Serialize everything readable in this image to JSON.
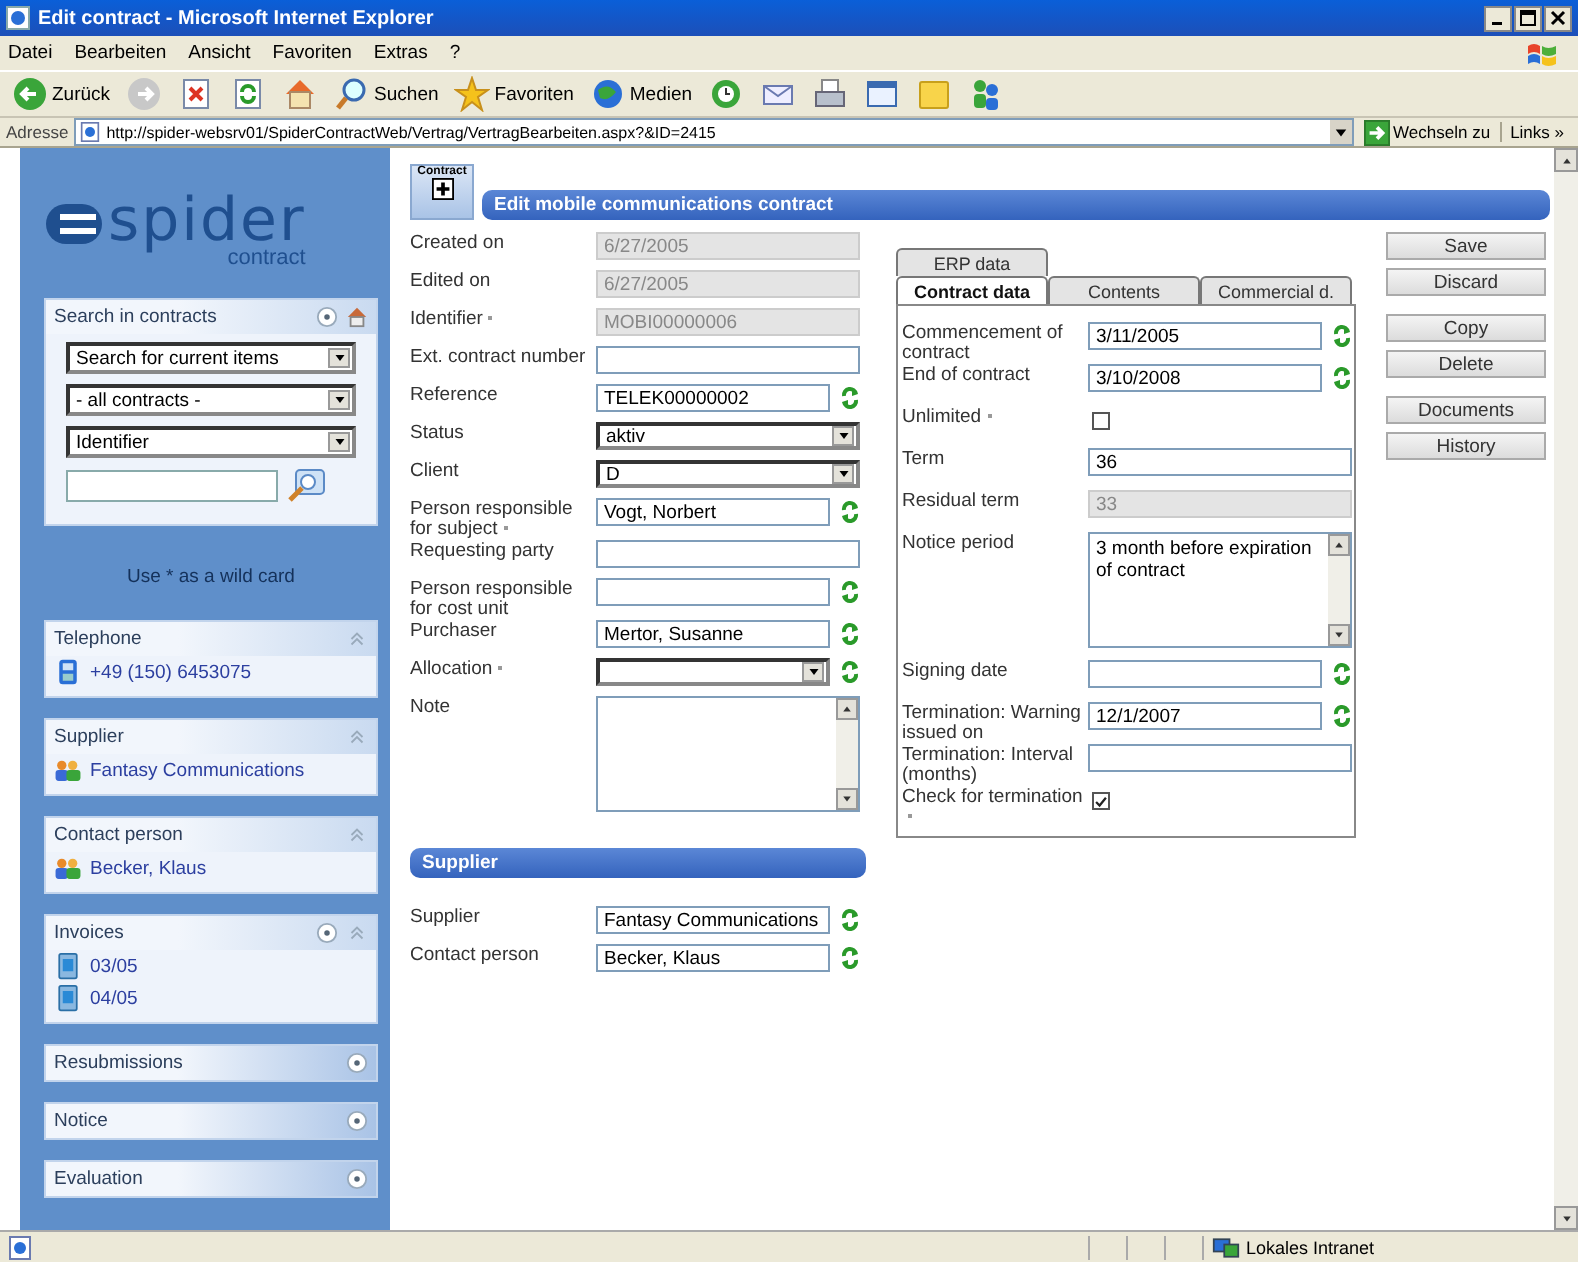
{
  "window": {
    "title": "Edit contract - Microsoft Internet Explorer"
  },
  "menu": [
    "Datei",
    "Bearbeiten",
    "Ansicht",
    "Favoriten",
    "Extras",
    "?"
  ],
  "toolbar": [
    {
      "kind": "back",
      "label": "Zurück"
    },
    {
      "kind": "forward"
    },
    {
      "kind": "stop"
    },
    {
      "kind": "refresh"
    },
    {
      "kind": "home"
    },
    {
      "kind": "search",
      "label": "Suchen"
    },
    {
      "kind": "favorites",
      "label": "Favoriten"
    },
    {
      "kind": "media",
      "label": "Medien"
    },
    {
      "kind": "history"
    },
    {
      "kind": "mail"
    },
    {
      "kind": "print"
    },
    {
      "kind": "edit"
    },
    {
      "kind": "folder"
    },
    {
      "kind": "messenger"
    }
  ],
  "address": {
    "label": "Adresse",
    "url": "http://spider-websrv01/SpiderContractWeb/Vertrag/VertragBearbeiten.aspx?&ID=2415",
    "go": "Wechseln zu",
    "links": "Links »"
  },
  "sidebar": {
    "logo": {
      "name": "spider",
      "sub": "contract"
    },
    "search": {
      "title": "Search in contracts",
      "selects": [
        "Search for current items",
        "- all contracts -",
        "Identifier"
      ]
    },
    "hint": "Use * as a wild card",
    "panels": [
      {
        "title": "Telephone",
        "add": false,
        "expanded": true,
        "items": [
          {
            "kind": "phone",
            "text": "+49 (150) 6453075"
          }
        ]
      },
      {
        "title": "Supplier",
        "add": false,
        "expanded": true,
        "items": [
          {
            "kind": "people",
            "text": "Fantasy Communications"
          }
        ]
      },
      {
        "title": "Contact person",
        "add": false,
        "expanded": true,
        "items": [
          {
            "kind": "people",
            "text": "Becker, Klaus"
          }
        ]
      },
      {
        "title": "Invoices",
        "add": true,
        "expanded": true,
        "items": [
          {
            "kind": "document",
            "text": "03/05"
          },
          {
            "kind": "document",
            "text": "04/05"
          }
        ]
      },
      {
        "title": "Resubmissions",
        "add": true,
        "expanded": false
      },
      {
        "title": "Notice",
        "add": true,
        "expanded": false
      },
      {
        "title": "Evaluation",
        "add": true,
        "expanded": false
      }
    ]
  },
  "page": {
    "badge": "Contract",
    "title": "Edit mobile communications contract",
    "fields": [
      {
        "label": "Created on",
        "kind": "text",
        "value": "6/27/2005",
        "disabled": true,
        "sync": false,
        "required": false
      },
      {
        "label": "Edited on",
        "kind": "text",
        "value": "6/27/2005",
        "disabled": true,
        "sync": false,
        "required": false
      },
      {
        "label": "Identifier",
        "kind": "text",
        "value": "MOBI00000006",
        "disabled": true,
        "sync": false,
        "required": true
      },
      {
        "label": "Ext. contract number",
        "kind": "text",
        "disabled": false,
        "sync": false,
        "required": false
      },
      {
        "label": "Reference",
        "kind": "text",
        "value": "TELEK00000002",
        "disabled": false,
        "sync": true,
        "required": false
      },
      {
        "label": "Status",
        "kind": "select",
        "value": "aktiv",
        "disabled": false,
        "sync": false,
        "required": false
      },
      {
        "label": "Client",
        "kind": "select",
        "value": "D",
        "disabled": false,
        "sync": false,
        "required": false
      },
      {
        "label": "Person responsible for subject",
        "kind": "text",
        "value": "Vogt, Norbert",
        "disabled": false,
        "sync": true,
        "required": true
      },
      {
        "label": "Requesting party",
        "kind": "text",
        "disabled": false,
        "sync": false,
        "required": false
      },
      {
        "label": "Person responsible for cost unit",
        "kind": "text",
        "disabled": false,
        "sync": true,
        "required": false
      },
      {
        "label": "Purchaser",
        "kind": "text",
        "value": "Mertor, Susanne",
        "disabled": false,
        "sync": true,
        "required": false
      },
      {
        "label": "Allocation",
        "kind": "select",
        "disabled": false,
        "sync": true,
        "required": true
      },
      {
        "label": "Note",
        "kind": "textarea",
        "disabled": false,
        "sync": false,
        "required": false
      }
    ],
    "supplier_section": {
      "title": "Supplier",
      "fields": [
        {
          "label": "Supplier",
          "kind": "text",
          "value": "Fantasy Communications",
          "disabled": false,
          "sync": true,
          "required": false
        },
        {
          "label": "Contact person",
          "kind": "text",
          "value": "Becker, Klaus",
          "disabled": false,
          "sync": true,
          "required": false
        }
      ]
    },
    "tab_rows": [
      [
        {
          "label": "ERP data",
          "selected": false
        }
      ],
      [
        {
          "label": "Contract data",
          "selected": true
        },
        {
          "label": "Contents",
          "selected": false
        },
        {
          "label": "Commercial d.",
          "selected": false
        }
      ]
    ],
    "tab_fields": [
      {
        "label": "Commencement of contract",
        "kind": "text",
        "value": "3/11/2005",
        "disabled": false,
        "sync": true,
        "required": false
      },
      {
        "label": "End of contract",
        "kind": "text",
        "value": "3/10/2008",
        "disabled": false,
        "sync": true,
        "required": false
      },
      {
        "label": "Unlimited",
        "kind": "checkbox",
        "checked": false,
        "disabled": false,
        "required": true
      },
      {
        "label": "Term",
        "kind": "text",
        "value": "36",
        "disabled": false,
        "sync": false,
        "required": false
      },
      {
        "label": "Residual term",
        "kind": "text",
        "value": "33",
        "disabled": true,
        "sync": false,
        "required": false
      },
      {
        "label": "Notice period",
        "kind": "textarea",
        "value": "3 month before expiration of contract",
        "disabled": false,
        "sync": false,
        "required": false
      },
      {
        "label": "Signing date",
        "kind": "text",
        "disabled": false,
        "sync": true,
        "required": false
      },
      {
        "label": "Termination: Warning issued on",
        "kind": "text",
        "value": "12/1/2007",
        "disabled": false,
        "sync": true,
        "required": false
      },
      {
        "label": "Termination: Interval (months)",
        "kind": "text",
        "disabled": false,
        "sync": false,
        "required": false
      },
      {
        "label": "Check for termination",
        "kind": "checkbox",
        "checked": true,
        "disabled": false,
        "required": true
      }
    ],
    "button_groups": [
      [
        "Save",
        "Discard"
      ],
      [
        "Copy",
        "Delete"
      ],
      [
        "Documents",
        "History"
      ]
    ]
  },
  "status_bar": {
    "zone": "Lokales Intranet"
  }
}
